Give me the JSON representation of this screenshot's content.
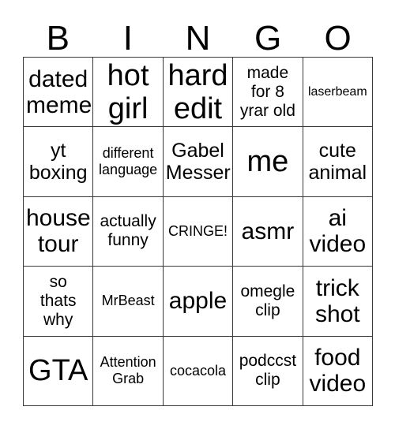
{
  "card": {
    "title": "BINGO",
    "header_letters": [
      "B",
      "I",
      "N",
      "G",
      "O"
    ],
    "grid": {
      "columns": 5,
      "rows": 5,
      "border_color": "#3a3a3a",
      "background_color": "#ffffff",
      "text_color": "#000000"
    },
    "cells": [
      {
        "text": "dated\nmeme",
        "size": "fs-lg"
      },
      {
        "text": "hot\ngirl",
        "size": "fs-xl"
      },
      {
        "text": "hard\nedit",
        "size": "fs-xl"
      },
      {
        "text": "made\nfor 8\nyrar old",
        "size": "fs-sm"
      },
      {
        "text": "laserbeam",
        "size": "fs-xxs"
      },
      {
        "text": "yt\nboxing",
        "size": "fs-md"
      },
      {
        "text": "different\nlanguage",
        "size": "fs-xs"
      },
      {
        "text": "Gabel\nMesser",
        "size": "fs-md"
      },
      {
        "text": "me",
        "size": "fs-xl"
      },
      {
        "text": "cute\nanimal",
        "size": "fs-md"
      },
      {
        "text": "house\ntour",
        "size": "fs-lg"
      },
      {
        "text": "actually\nfunny",
        "size": "fs-sm"
      },
      {
        "text": "CRINGE!",
        "size": "fs-xs"
      },
      {
        "text": "asmr",
        "size": "fs-lg"
      },
      {
        "text": "ai\nvideo",
        "size": "fs-lg"
      },
      {
        "text": "so\nthats\nwhy",
        "size": "fs-sm"
      },
      {
        "text": "MrBeast",
        "size": "fs-xs"
      },
      {
        "text": "apple",
        "size": "fs-lg"
      },
      {
        "text": "omegle\nclip",
        "size": "fs-sm"
      },
      {
        "text": "trick\nshot",
        "size": "fs-lg"
      },
      {
        "text": "GTA",
        "size": "fs-xl"
      },
      {
        "text": "Attention\nGrab",
        "size": "fs-xs"
      },
      {
        "text": "cocacola",
        "size": "fs-xs"
      },
      {
        "text": "podccst\nclip",
        "size": "fs-sm"
      },
      {
        "text": "food\nvideo",
        "size": "fs-lg"
      }
    ]
  }
}
